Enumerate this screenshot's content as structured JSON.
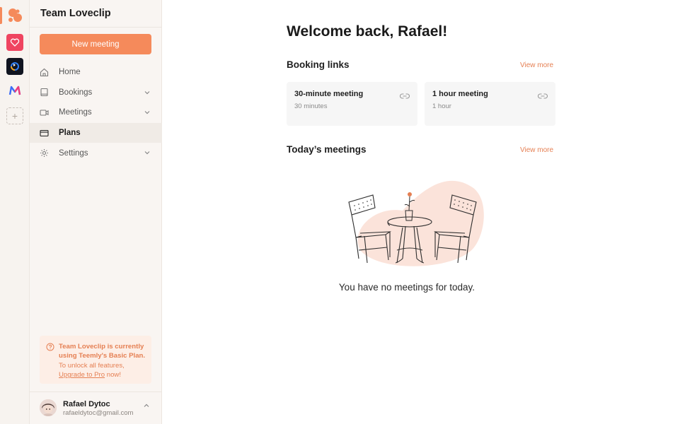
{
  "rail": {
    "icons": [
      "team-loveclip-logo",
      "heart-app-icon",
      "refresh-app-icon",
      "m-app-icon",
      "add-workspace-icon"
    ]
  },
  "sidebar": {
    "team_name": "Team Loveclip",
    "new_meeting_label": "New meeting",
    "items": [
      {
        "label": "Home",
        "icon": "home-icon",
        "expandable": false
      },
      {
        "label": "Bookings",
        "icon": "book-icon",
        "expandable": true
      },
      {
        "label": "Meetings",
        "icon": "video-icon",
        "expandable": true
      },
      {
        "label": "Plans",
        "icon": "credit-card-icon",
        "expandable": false,
        "active": true
      },
      {
        "label": "Settings",
        "icon": "gear-icon",
        "expandable": true
      }
    ],
    "upgrade": {
      "line_strong": "Team Loveclip is currently using Teemly's Basic Plan.",
      "line_normal": "To unlock all features,",
      "link": "Upgrade to Pro",
      "suffix": " now!"
    },
    "user": {
      "name": "Rafael Dytoc",
      "email": "rafaeldytoc@gmail.com"
    }
  },
  "main": {
    "welcome": "Welcome back, Rafael!",
    "booking_links": {
      "title": "Booking links",
      "view_more": "View more",
      "cards": [
        {
          "title": "30-minute meeting",
          "subtitle": "30 minutes"
        },
        {
          "title": "1 hour meeting",
          "subtitle": "1 hour"
        }
      ]
    },
    "todays_meetings": {
      "title": "Today’s meetings",
      "view_more": "View more",
      "empty_text": "You have no meetings for today."
    }
  },
  "colors": {
    "accent": "#f58a5b",
    "accent_text": "#e57f52",
    "sidebar_bg": "#f9f5f2",
    "upgrade_bg": "#fdeee6"
  }
}
